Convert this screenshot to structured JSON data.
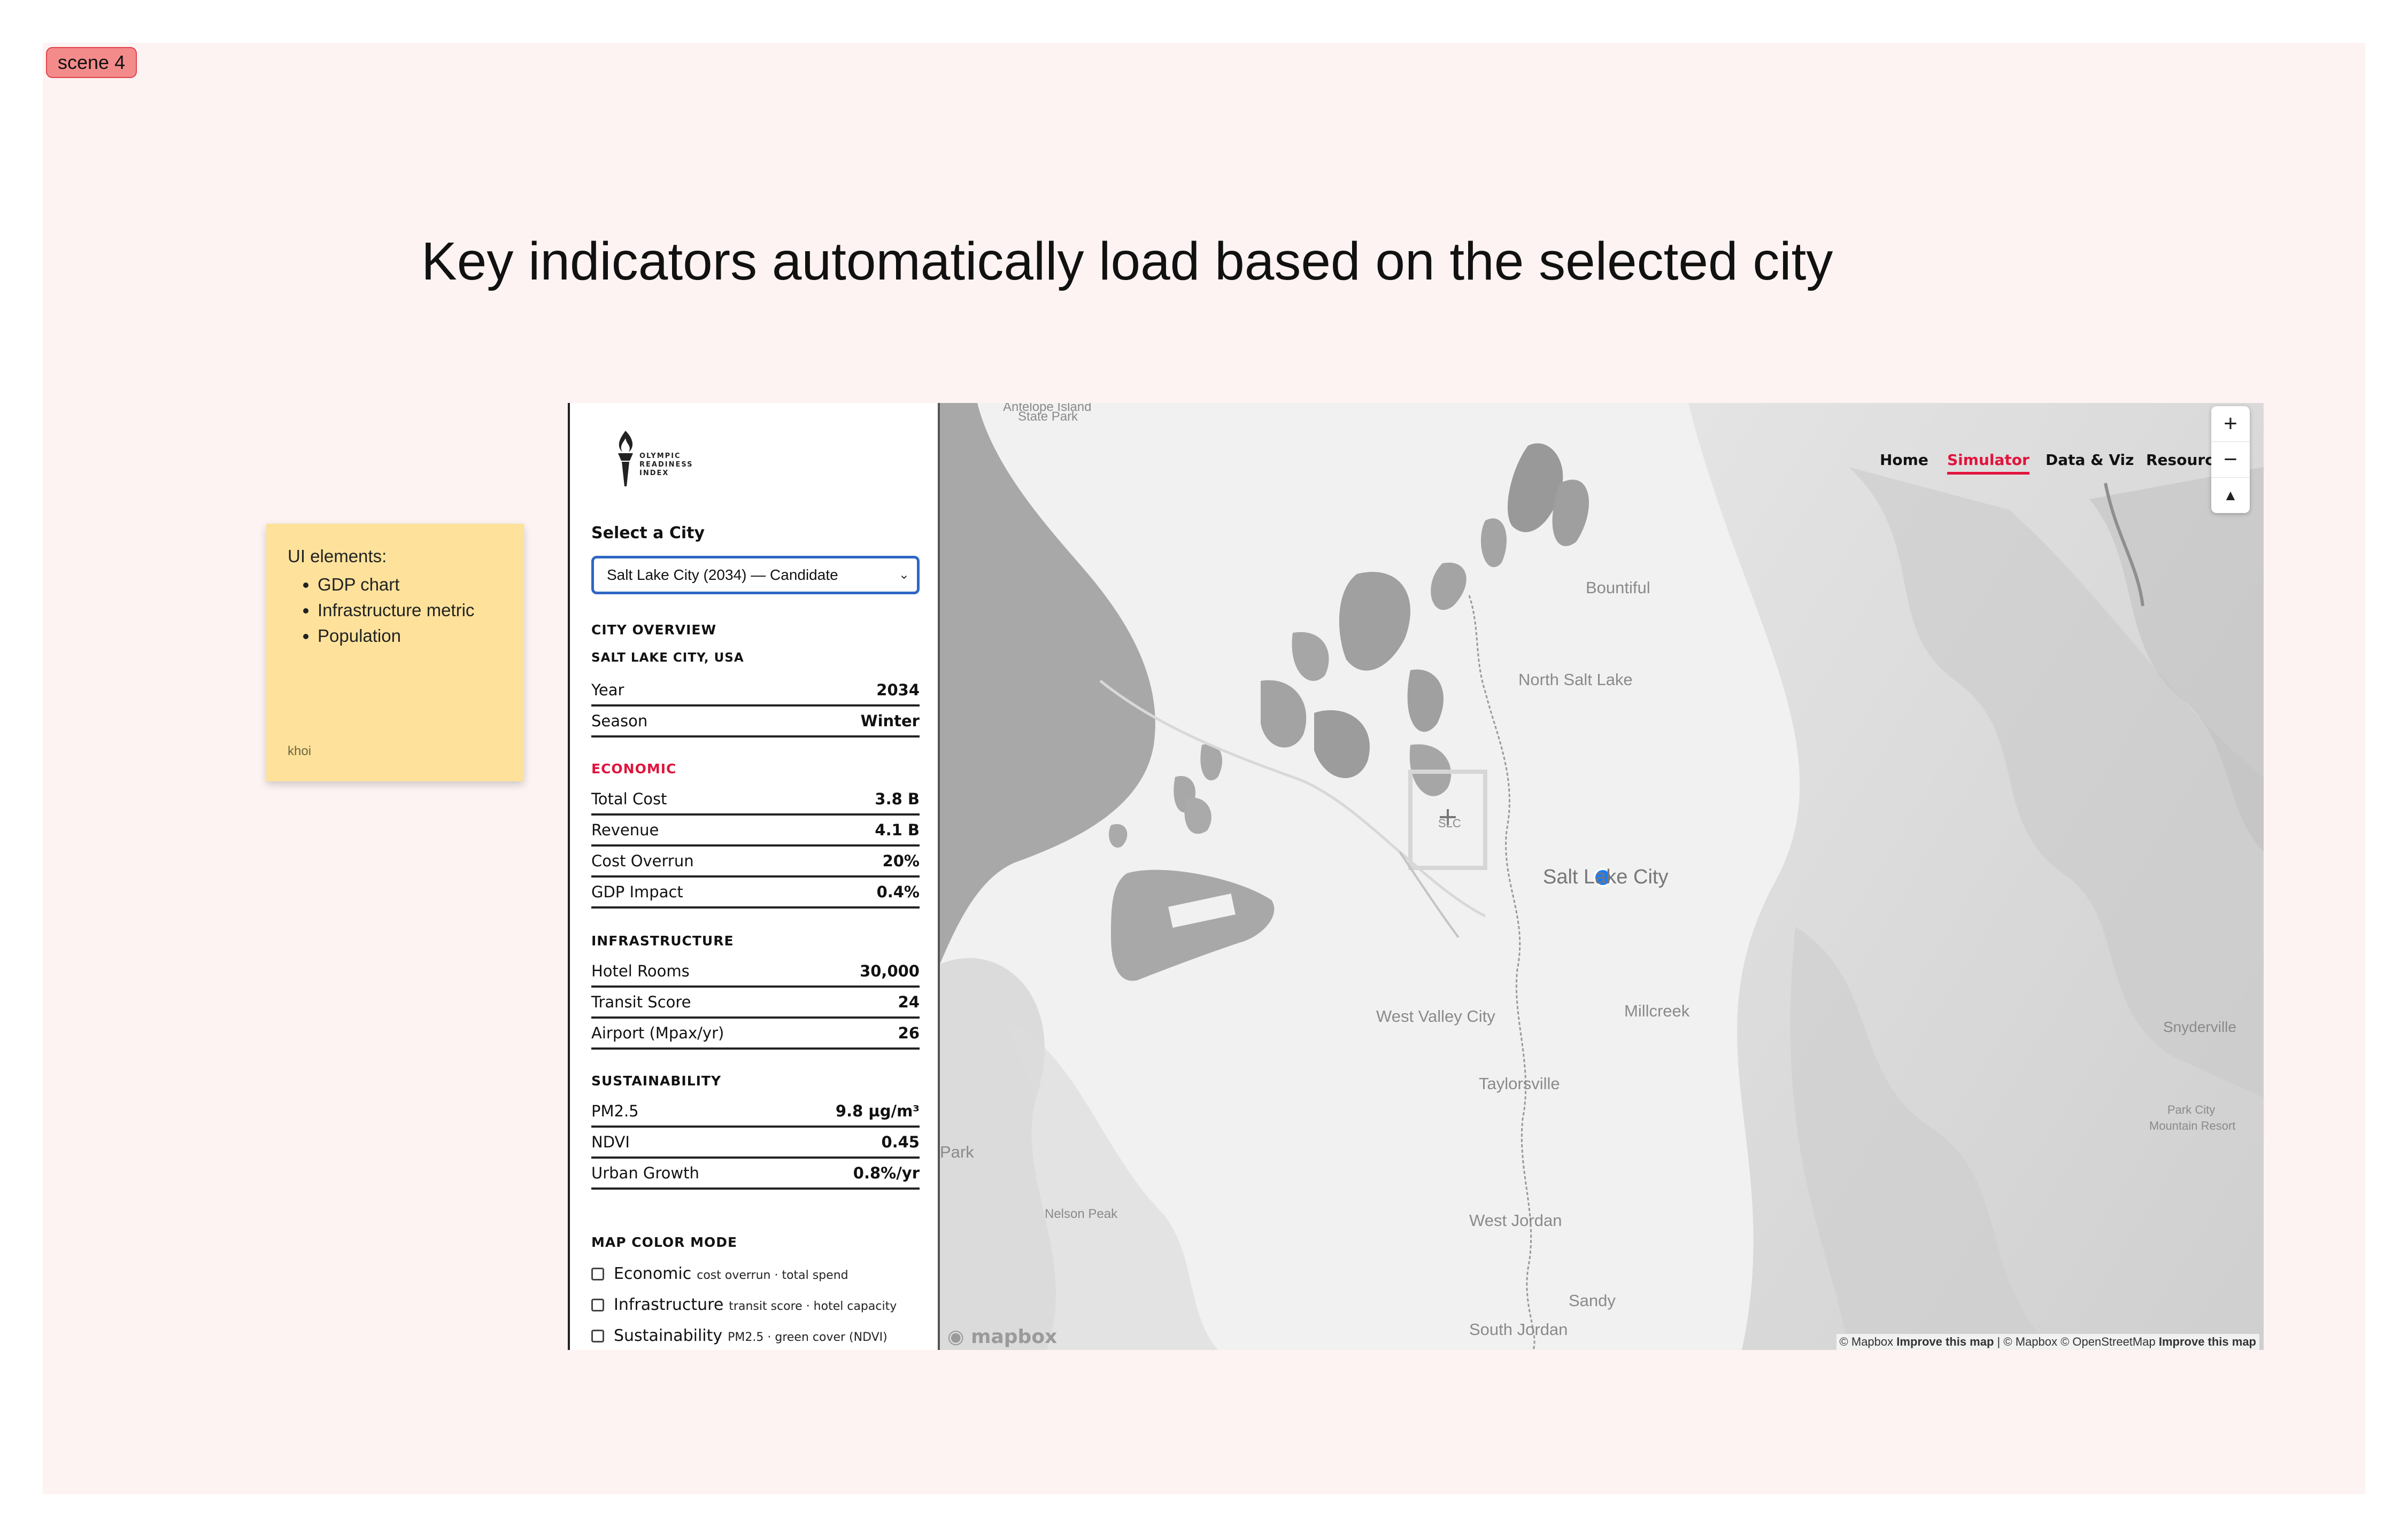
{
  "scene_tag": "scene 4",
  "heading": "Key indicators automatically load based on the selected city",
  "sticky": {
    "title": "UI elements:",
    "items": [
      "GDP chart",
      "Infrastructure metric",
      "Population"
    ],
    "author": "khoi"
  },
  "sidebar": {
    "logo_lines": [
      "OLYMPIC",
      "READINESS",
      "INDEX"
    ],
    "select_label": "Select a City",
    "select_value": "Salt Lake City (2034) — Candidate",
    "overview_title": "CITY OVERVIEW",
    "city_name": "SALT LAKE CITY, USA",
    "overview": [
      {
        "k": "Year",
        "v": "2034"
      },
      {
        "k": "Season",
        "v": "Winter"
      }
    ],
    "economic_title": "ECONOMIC",
    "economic": [
      {
        "k": "Total Cost",
        "v": "3.8 B"
      },
      {
        "k": "Revenue",
        "v": "4.1 B"
      },
      {
        "k": "Cost Overrun",
        "v": "20%"
      },
      {
        "k": "GDP Impact",
        "v": "0.4%"
      }
    ],
    "infrastructure_title": "INFRASTRUCTURE",
    "infrastructure": [
      {
        "k": "Hotel Rooms",
        "v": "30,000"
      },
      {
        "k": "Transit Score",
        "v": "24"
      },
      {
        "k": "Airport (Mpax/yr)",
        "v": "26"
      }
    ],
    "sustainability_title": "SUSTAINABILITY",
    "sustainability": [
      {
        "k": "PM2.5",
        "v": "9.8 µg/m³"
      },
      {
        "k": "NDVI",
        "v": "0.45"
      },
      {
        "k": "Urban Growth",
        "v": "0.8%/yr"
      }
    ],
    "mode_title": "MAP COLOR MODE",
    "modes": [
      {
        "label": "Economic",
        "hint": "cost overrun · total spend"
      },
      {
        "label": "Infrastructure",
        "hint": "transit score · hotel capacity"
      },
      {
        "label": "Sustainability",
        "hint": "PM2.5 · green cover (NDVI)"
      }
    ]
  },
  "nav": {
    "home": "Home",
    "simulator": "Simulator",
    "data_viz": "Data & Viz",
    "resources": "Resources"
  },
  "map": {
    "labels": {
      "antelope": "Antelope Island",
      "state_park": "State Park",
      "bountiful": "Bountiful",
      "north_salt_lake": "North Salt Lake",
      "slc_airport": "SLC",
      "salt_lake_city": "Salt Lake City",
      "millcreek": "Millcreek",
      "west_valley": "West Valley City",
      "taylorsville": "Taylorsville",
      "snyderville": "Snyderville",
      "park_city": "Park City",
      "park_city_resort": "Mountain Resort",
      "park": "Park",
      "nelson_peak": "Nelson Peak",
      "west_jordan": "West Jordan",
      "sandy": "Sandy",
      "south_jordan": "South Jordan"
    },
    "zoom_in": "+",
    "zoom_out": "−",
    "compass": "▲",
    "mapbox_logo": "mapbox",
    "attribution_1": "© Mapbox",
    "improve_1": "Improve this map",
    "attribution_2": "| © Mapbox © OpenStreetMap",
    "improve_2": "Improve this map"
  }
}
